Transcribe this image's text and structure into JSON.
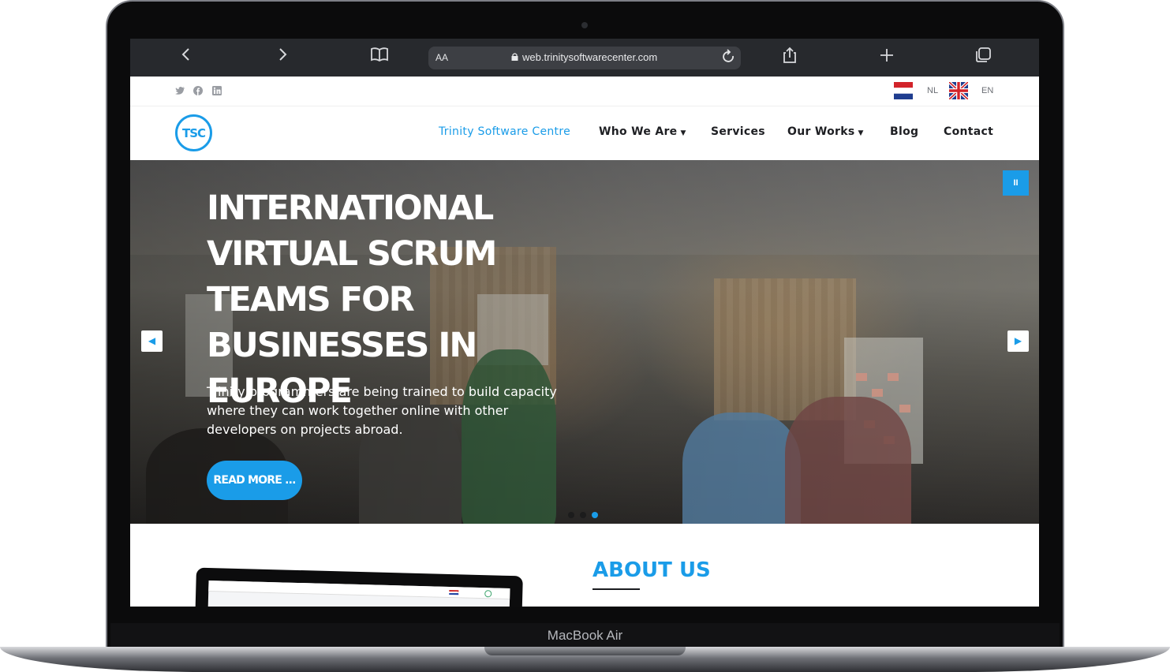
{
  "device": {
    "model": "MacBook Air"
  },
  "browser": {
    "back_icon": "chevron-left-icon",
    "forward_icon": "chevron-right-icon",
    "bookmarks_icon": "book-icon",
    "reader_label": "AA",
    "url": "web.trinitysoftwarecenter.com",
    "reload_icon": "reload-icon",
    "share_icon": "share-icon",
    "new_tab_icon": "plus-icon",
    "tabs_icon": "tabs-icon"
  },
  "utility": {
    "social": [
      "twitter-icon",
      "facebook-icon",
      "linkedin-icon"
    ],
    "languages": [
      {
        "code": "NL",
        "flag": "netherlands-flag"
      },
      {
        "code": "EN",
        "flag": "uk-flag"
      }
    ]
  },
  "nav": {
    "logo_text": "TSC",
    "items": [
      {
        "label": "Trinity Software Centre",
        "active": true
      },
      {
        "label": "Who We Are",
        "dropdown": true
      },
      {
        "label": "Services"
      },
      {
        "label": "Our Works",
        "dropdown": true
      },
      {
        "label": "Blog"
      },
      {
        "label": "Contact"
      }
    ]
  },
  "hero": {
    "title": "INTERNATIONAL VIRTUAL SCRUM TEAMS FOR BUSINESSES IN EUROPE",
    "text": "Trinity programmers are being trained to build capacity where they can work together online with other developers on projects abroad.",
    "cta_label": "READ MORE ...",
    "prev_icon": "arrow-left-icon",
    "next_icon": "arrow-right-icon",
    "pause_icon": "pause-icon",
    "slide_count": 3,
    "active_slide": 3
  },
  "about": {
    "title": "ABOUT US"
  },
  "colors": {
    "accent": "#1a9ce8",
    "chrome": "#27292d",
    "nav_text": "#1e1f23"
  }
}
